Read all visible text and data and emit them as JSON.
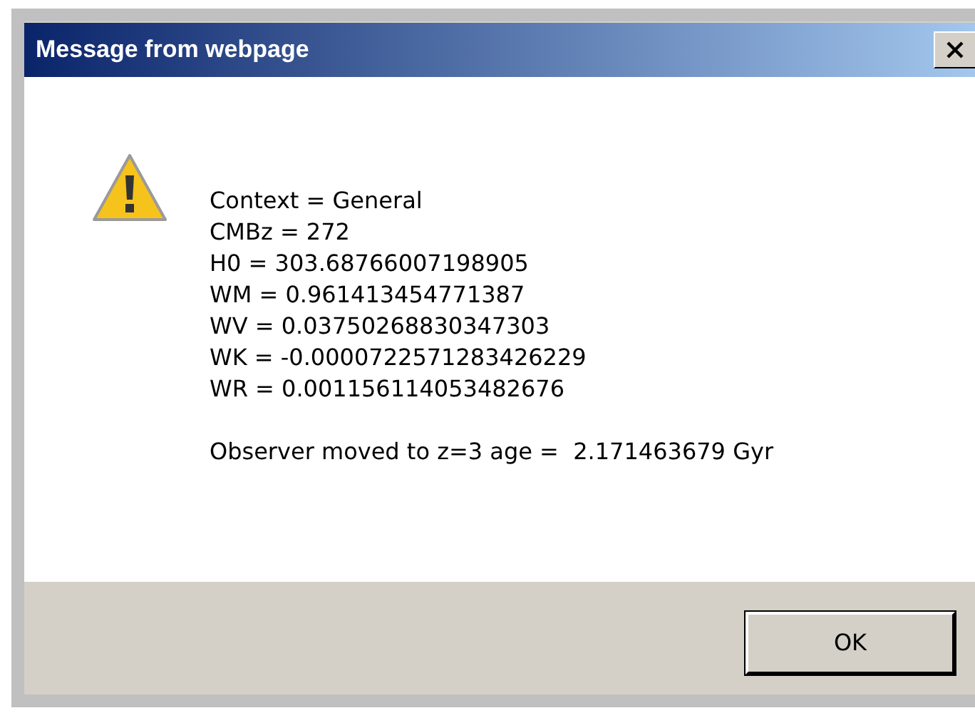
{
  "window": {
    "title": "Message from webpage"
  },
  "message": {
    "lines": [
      "Context = General",
      "CMBz = 272",
      "H0 = 303.68766007198905",
      "WM = 0.961413454771387",
      "WV = 0.03750268830347303",
      "WK = -0.0000722571283426229",
      "WR = 0.001156114053482676"
    ],
    "result": "Observer moved to z=3 age =  2.171463679 Gyr"
  },
  "buttons": [
    "OK"
  ]
}
